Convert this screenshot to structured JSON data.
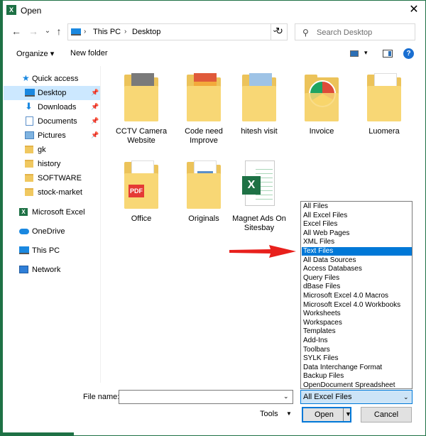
{
  "window": {
    "title": "Open",
    "app_icon": "X",
    "close_glyph": "✕",
    "accent_color": "#1e7145"
  },
  "nav": {
    "back_glyph": "←",
    "forward_glyph": "→",
    "dropdown_glyph": "⌄",
    "up_glyph": "↑",
    "breadcrumbs": [
      "This PC",
      "Desktop"
    ],
    "crumb_sep": "›",
    "addr_dd_glyph": "⌄",
    "refresh_glyph": "↻",
    "search_icon": "⚲",
    "search_placeholder": "Search Desktop"
  },
  "toolbar": {
    "organize_label": "Organize ▾",
    "new_folder_label": "New folder",
    "view_dd_glyph": "▾",
    "help_glyph": "?"
  },
  "sidebar": {
    "pin_glyph": "📌",
    "quick_access": "Quick access",
    "star_glyph": "★",
    "items": [
      {
        "label": "Desktop",
        "icon": "desktop-icon",
        "pinned": true
      },
      {
        "label": "Downloads",
        "icon": "download-icon",
        "pinned": true
      },
      {
        "label": "Documents",
        "icon": "documents-icon",
        "pinned": true
      },
      {
        "label": "Pictures",
        "icon": "pictures-icon",
        "pinned": true
      },
      {
        "label": "gk",
        "icon": "folder-icon",
        "pinned": false
      },
      {
        "label": "history",
        "icon": "folder-icon",
        "pinned": false
      },
      {
        "label": "SOFTWARE",
        "icon": "folder-icon",
        "pinned": false
      },
      {
        "label": "stock-market",
        "icon": "folder-icon",
        "pinned": false
      }
    ],
    "excel": "Microsoft Excel",
    "excel_glyph": "X",
    "onedrive": "OneDrive",
    "this_pc": "This PC",
    "network": "Network"
  },
  "files": [
    {
      "name": "CCTV Camera Website",
      "icon": "folder-laptop-icon",
      "page_color": "#7a7a7a"
    },
    {
      "name": "Code need Improve",
      "icon": "folder-chart-icon",
      "page_color": "#e05a3a"
    },
    {
      "name": "hitesh visit",
      "icon": "folder-photo-icon",
      "page_color": "#5b8fc9"
    },
    {
      "name": "Invoice",
      "icon": "folder-chrome-icon",
      "page_color": "#dd4b39"
    },
    {
      "name": "Luomera",
      "icon": "folder-doc-icon",
      "page_color": "#ffffff"
    },
    {
      "name": "Office",
      "icon": "folder-pdf-icon",
      "page_color": "#e53935"
    },
    {
      "name": "Originals",
      "icon": "folder-doc-blue-icon",
      "page_color": "#5b8fc9"
    },
    {
      "name": "Magnet Ads On Sitesbay",
      "icon": "excel-file-icon",
      "page_color": "#1e7145"
    }
  ],
  "pdf_label": "PDF",
  "excel_badge": "X",
  "file_types": [
    "All Files",
    "All Excel Files",
    "Excel Files",
    "All Web Pages",
    "XML Files",
    "Text Files",
    "All Data Sources",
    "Access Databases",
    "Query Files",
    "dBase Files",
    "Microsoft Excel 4.0 Macros",
    "Microsoft Excel 4.0 Workbooks",
    "Worksheets",
    "Workspaces",
    "Templates",
    "Add-Ins",
    "Toolbars",
    "SYLK Files",
    "Data Interchange Format",
    "Backup Files",
    "OpenDocument Spreadsheet"
  ],
  "selected_file_type": "Text Files",
  "bottom": {
    "file_name_label": "File name:",
    "file_name_value": "",
    "fn_dd_glyph": "⌄",
    "filter_value": "All Excel Files",
    "filter_dd_glyph": "⌄",
    "tools_label": "Tools",
    "tools_dd_glyph": "▼",
    "open_label": "Open",
    "open_dd_glyph": "▼",
    "cancel_label": "Cancel"
  },
  "annotation_color": "#e8201c"
}
